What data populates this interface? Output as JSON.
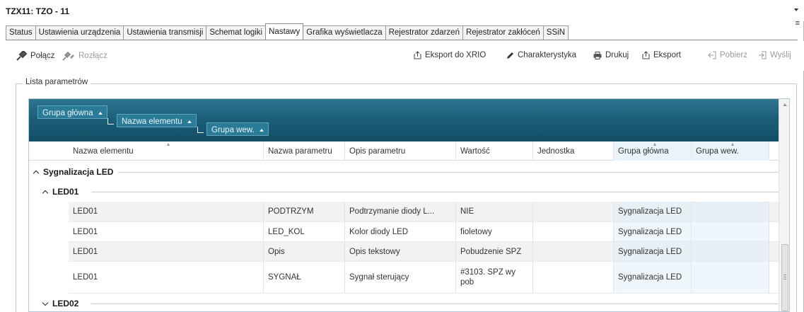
{
  "window": {
    "title": "TZX11: TZO - 11"
  },
  "tabs": [
    {
      "label": "Status",
      "active": false
    },
    {
      "label": "Ustawienia urządzenia",
      "active": false
    },
    {
      "label": "Ustawienia transmisji",
      "active": false
    },
    {
      "label": "Schemat logiki",
      "active": false
    },
    {
      "label": "Nastawy",
      "active": true
    },
    {
      "label": "Grafika wyświetlacza",
      "active": false
    },
    {
      "label": "Rejestrator zdarzeń",
      "active": false
    },
    {
      "label": "Rejestrator zakłóceń",
      "active": false
    },
    {
      "label": "SSiN",
      "active": false
    }
  ],
  "toolbar": {
    "connect": "Połącz",
    "disconnect": "Rozłącz",
    "export_xrio": "Eksport do XRIO",
    "characteristic": "Charakterystyka",
    "print": "Drukuj",
    "export": "Eksport",
    "fetch": "Pobierz",
    "send": "Wyślij"
  },
  "parameter_list": {
    "title": "Lista parametrów",
    "grouping": [
      "Grupa główna",
      "Nazwa elementu",
      "Grupa wew."
    ],
    "columns": [
      "Nazwa elementu",
      "Nazwa parametru",
      "Opis parametru",
      "Wartość",
      "Jednostka",
      "Grupa główna",
      "Grupa wew."
    ],
    "main_group": {
      "label": "Sygnalizacja LED",
      "expanded": true
    },
    "subgroups": [
      {
        "label": "LED01",
        "expanded": true,
        "rows": [
          [
            "LED01",
            "PODTRZYM",
            "Podtrzymanie diody L...",
            "NIE",
            "",
            "Sygnalizacja LED",
            ""
          ],
          [
            "LED01",
            "LED_KOL",
            "Kolor diody LED",
            "fioletowy",
            "",
            "Sygnalizacja LED",
            ""
          ],
          [
            "LED01",
            "Opis",
            "Opis tekstowy",
            "Pobudzenie SPZ",
            "",
            "Sygnalizacja LED",
            ""
          ],
          [
            "LED01",
            "SYGNAŁ",
            "Sygnał sterujący",
            "#3103. SPZ wy pob",
            "",
            "Sygnalizacja LED",
            ""
          ]
        ]
      },
      {
        "label": "LED02",
        "expanded": false
      }
    ]
  },
  "colors": {
    "group_panel": "#1c5f78",
    "chip": "#2a7b98",
    "highlight_column": "#e8f3fa"
  }
}
